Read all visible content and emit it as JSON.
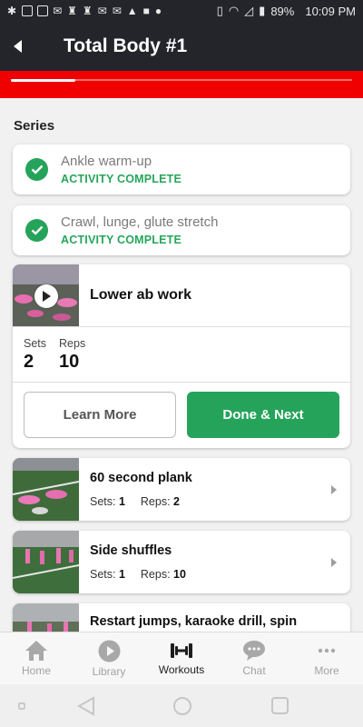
{
  "status_bar": {
    "battery": "89%",
    "time": "10:09 PM",
    "notification_icons": [
      "slack-icon",
      "gallery-icon",
      "lock-icon",
      "mail-icon",
      "chess-icon",
      "chess-icon",
      "gmail-icon",
      "gmail-icon",
      "warning-icon",
      "video-icon",
      "skype-icon"
    ]
  },
  "app_bar": {
    "title": "Total Body #1"
  },
  "progress": {
    "fraction": 0.19
  },
  "series": {
    "label": "Series",
    "completed": [
      {
        "title": "Ankle warm-up",
        "status": "ACTIVITY COMPLETE"
      },
      {
        "title": "Crawl, lunge, glute stretch",
        "status": "ACTIVITY COMPLETE"
      }
    ],
    "current": {
      "title": "Lower ab work",
      "sets_label": "Sets",
      "sets_value": "2",
      "reps_label": "Reps",
      "reps_value": "10",
      "learn_more_label": "Learn More",
      "done_next_label": "Done & Next"
    },
    "upcoming": [
      {
        "title": "60 second plank",
        "sets_label": "Sets:",
        "sets": "1",
        "reps_label": "Reps:",
        "reps": "2"
      },
      {
        "title": "Side shuffles",
        "sets_label": "Sets:",
        "sets": "1",
        "reps_label": "Reps:",
        "reps": "10"
      },
      {
        "title": "Restart jumps, karaoke drill, spin",
        "sets_label": "",
        "sets": "",
        "reps_label": "",
        "reps": ""
      }
    ]
  },
  "bottom_nav": [
    {
      "label": "Home",
      "icon": "home-icon"
    },
    {
      "label": "Library",
      "icon": "play-circle-icon"
    },
    {
      "label": "Workouts",
      "icon": "dumbbell-icon",
      "active": true
    },
    {
      "label": "Chat",
      "icon": "chat-bubble-icon"
    },
    {
      "label": "More",
      "icon": "more-dots-icon"
    }
  ],
  "colors": {
    "app_bar": "#24252b",
    "accent_red": "#f00000",
    "success_green": "#26a35a"
  }
}
